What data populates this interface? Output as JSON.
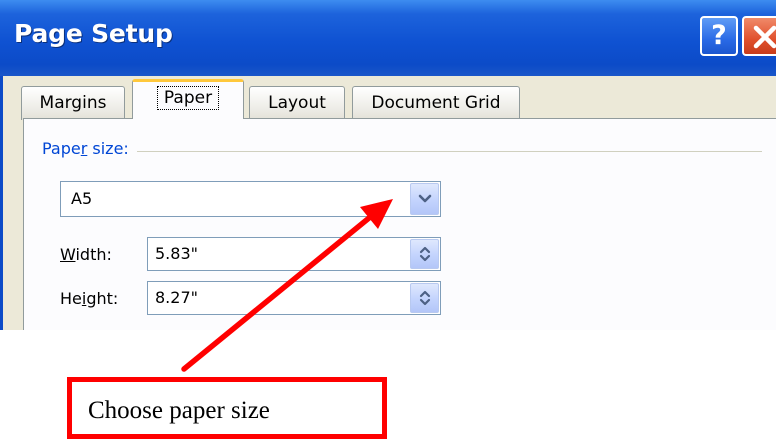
{
  "dialog": {
    "title": "Page Setup",
    "help_button": "?",
    "tabs": [
      {
        "label": "Margins",
        "active": false
      },
      {
        "label": "Paper",
        "active": true
      },
      {
        "label": "Layout",
        "active": false
      },
      {
        "label": "Document Grid",
        "active": false
      }
    ],
    "paper_size": {
      "label_start": "Pape",
      "label_accel": "r",
      "label_end": " size:",
      "value": "A5"
    },
    "width": {
      "label_accel": "W",
      "label_end": "idth:",
      "value": "5.83\""
    },
    "height": {
      "label_start": "He",
      "label_accel": "i",
      "label_end": "ght:",
      "value": "8.27\""
    }
  },
  "annotation": {
    "callout_text": "Choose paper size",
    "color": "#ff0000"
  },
  "colors": {
    "titlebar": "#0c4bc8",
    "dialog_face": "#ece9d8",
    "group_label": "#0046d5",
    "active_tab_accent": "#ffc83c"
  },
  "icons": {
    "help": "help-icon",
    "close": "close-icon",
    "dropdown": "chevron-down-icon",
    "spinner": "spin-arrows-icon"
  }
}
